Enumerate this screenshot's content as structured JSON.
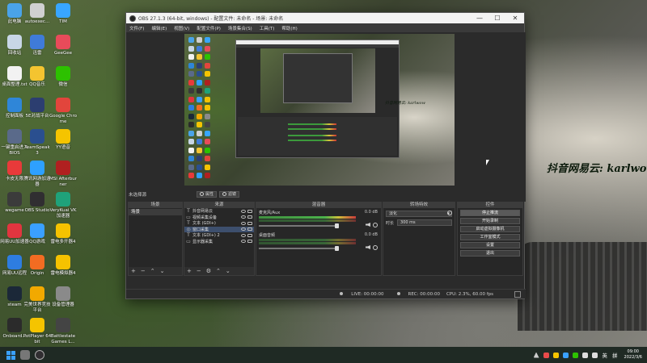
{
  "desktop": {
    "icons": [
      {
        "label": "此电脑",
        "color": "#4aa3e8"
      },
      {
        "label": "autoexec...",
        "color": "#d0d0d0"
      },
      {
        "label": "TIM",
        "color": "#38a6ff"
      },
      {
        "label": "回收站",
        "color": "#c8d6e6"
      },
      {
        "label": "迅雷",
        "color": "#3f7bd9"
      },
      {
        "label": "GeeGee",
        "color": "#e84b5a"
      },
      {
        "label": "桌面整理.txt",
        "color": "#f2f2f2"
      },
      {
        "label": "QQ音乐",
        "color": "#f4c430"
      },
      {
        "label": "微信",
        "color": "#2dc100"
      },
      {
        "label": "控制面板",
        "color": "#2f86d8"
      },
      {
        "label": "5E对战平台",
        "color": "#2c3e70"
      },
      {
        "label": "Google Chrome",
        "color": "#e2453c"
      },
      {
        "label": "一键重启进入BIOS",
        "color": "#5a6a8a"
      },
      {
        "label": "TeamSpeak 3",
        "color": "#2a4f8f"
      },
      {
        "label": "YY语音",
        "color": "#f5c400"
      },
      {
        "label": "卡皮无限",
        "color": "#e83a3a"
      },
      {
        "label": "腾讯网游加速器",
        "color": "#2ea0ff"
      },
      {
        "label": "MSI Afterburner",
        "color": "#b02020"
      },
      {
        "label": "wegame",
        "color": "#3b3b3b"
      },
      {
        "label": "OBS Studio",
        "color": "#302e31"
      },
      {
        "label": "VeryKuai VK加速器",
        "color": "#1fa27a"
      },
      {
        "label": "网易UU加速器",
        "color": "#e2353f"
      },
      {
        "label": "QQ游戏",
        "color": "#3aa0ff"
      },
      {
        "label": "雷电多开器4",
        "color": "#f5c200"
      },
      {
        "label": "网易UU远程",
        "color": "#2e7de0"
      },
      {
        "label": "Origin",
        "color": "#f26c22"
      },
      {
        "label": "雷电模拟器4",
        "color": "#f5c200"
      },
      {
        "label": "steam",
        "color": "#1b2838"
      },
      {
        "label": "完美世界竞技平台",
        "color": "#f2a900"
      },
      {
        "label": "设备管理器",
        "color": "#8a8a8a"
      },
      {
        "label": "Onboard...",
        "color": "#2b2b2b"
      },
      {
        "label": "PotPlayer 64 bit",
        "color": "#f5c400"
      },
      {
        "label": "Battlestate Games L...",
        "color": "#444444"
      }
    ],
    "wallpaper_caption": "抖音网易云: karlwow"
  },
  "obs": {
    "title": "OBS 27.1.3 (64-bit, windows) - 配置文件: 未命名 - 场景: 未命名",
    "window_controls": {
      "minimize": "—",
      "maximize": "☐",
      "close": "✕"
    },
    "menu": [
      "文件(F)",
      "编辑(E)",
      "视图(V)",
      "配置文件(P)",
      "场景集合(S)",
      "工具(T)",
      "帮助(H)"
    ],
    "preview_caption": "抖音网易云: karlwow",
    "source_bar": {
      "selected_source": "未选择源",
      "properties": "属性",
      "filters": "滤镜"
    },
    "docks": {
      "scenes": {
        "title": "场景",
        "items": [
          "场景"
        ],
        "toolbar": [
          "+",
          "−",
          "⌃",
          "⌄"
        ]
      },
      "sources": {
        "title": "来源",
        "items": [
          {
            "icon": "T",
            "name": "抖音网易云",
            "selected": false
          },
          {
            "icon": "▭",
            "name": "视频采集设备",
            "selected": false
          },
          {
            "icon": "T",
            "name": "文本 (GDI+)",
            "selected": false
          },
          {
            "icon": "◎",
            "name": "窗口采集",
            "selected": true
          },
          {
            "icon": "T",
            "name": "文本 (GDI+) 2",
            "selected": false
          },
          {
            "icon": "▭",
            "name": "显示器采集",
            "selected": false
          }
        ],
        "toolbar": [
          "+",
          "−",
          "⚙",
          "⌃",
          "⌄"
        ]
      },
      "mixer": {
        "title": "混音器",
        "tracks": [
          {
            "name": "麦克风/Aux",
            "db": "0.0 dB",
            "level": 0.8
          },
          {
            "name": "桌面音频",
            "db": "0.0 dB",
            "level": 0.8
          }
        ]
      },
      "transitions": {
        "title": "转场特效",
        "selected": "淡化",
        "duration_label": "时长",
        "duration_value": "300 ms"
      },
      "controls": {
        "title": "控件",
        "buttons": [
          "停止推流",
          "开始录制",
          "启动虚拟摄像机",
          "工作室模式",
          "设置",
          "退出"
        ],
        "active_button": "停止推流"
      }
    },
    "status": {
      "live": "LIVE: 00:00:00",
      "rec": "REC: 00:00:00",
      "cpu": "CPU: 2.3%, 60.00 fps"
    }
  },
  "taskbar": {
    "tray_lang1": "英",
    "tray_lang2": "拼",
    "time": "09:00",
    "date": "2022/3/6"
  }
}
